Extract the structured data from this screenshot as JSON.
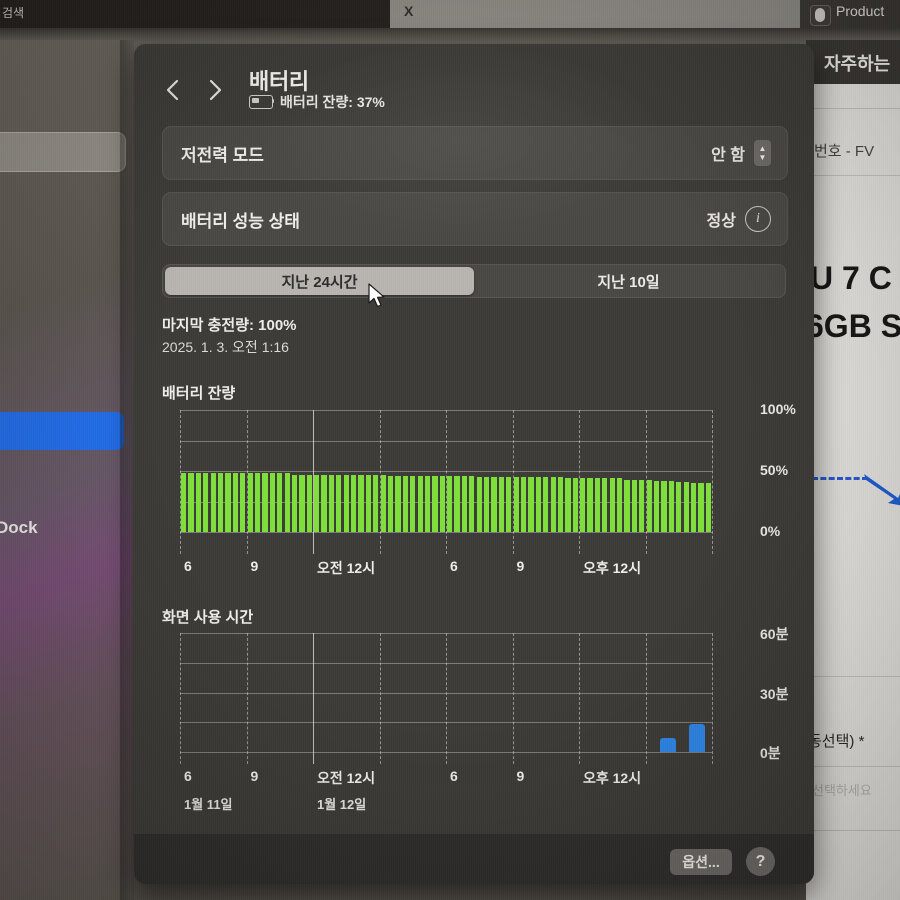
{
  "backdrop": {
    "topbar": {
      "search_text": "검색",
      "close_label": "X",
      "product_label": "Product"
    },
    "left_desktop": {
      "dock_label": "Dock"
    },
    "right_desktop": {
      "header": "자주하는",
      "subtitle": "번호 - FV",
      "big_line1": "U 7 C",
      "big_line2": "6GB S",
      "small_line": "동선택) *",
      "faint_line": "선택하세요"
    }
  },
  "window": {
    "title": "배터리",
    "subtitle": "배터리 잔량: 37%",
    "back_icon": "chevron-left-icon",
    "forward_icon": "chevron-right-icon",
    "rows": [
      {
        "label": "저전력 모드",
        "value": "안 함",
        "control": "stepper"
      },
      {
        "label": "배터리 성능 상태",
        "value": "정상",
        "control": "info"
      }
    ],
    "segments": [
      {
        "label": "지난 24시간",
        "selected": true
      },
      {
        "label": "지난 10일",
        "selected": false
      }
    ],
    "last_charge_label": "마지막 충전량: 100%",
    "last_charge_time": "2025. 1. 3. 오전 1:16",
    "footer": {
      "options_label": "옵션...",
      "help_label": "?"
    }
  },
  "chart_data": [
    {
      "type": "bar",
      "title": "배터리 잔량",
      "xlabel": "",
      "ylabel": "",
      "ylim": [
        0,
        100
      ],
      "ytick_labels": [
        "0%",
        "50%",
        "100%"
      ],
      "yticks": [
        0,
        50,
        100
      ],
      "gridlines_y": [
        0,
        25,
        50,
        75,
        100
      ],
      "xtick_labels": [
        "6",
        "9",
        "오전 12시",
        "6",
        "9",
        "오후 12시"
      ],
      "xticks_hours": [
        6,
        9,
        12,
        18,
        21,
        24
      ],
      "bar_color": "#7ee03a",
      "grid": true,
      "legend": "none",
      "x": [
        "06:00",
        "06:15",
        "06:30",
        "06:45",
        "07:00",
        "07:15",
        "07:30",
        "07:45",
        "08:00",
        "08:15",
        "08:30",
        "08:45",
        "09:00",
        "09:15",
        "09:30",
        "09:45",
        "10:00",
        "10:15",
        "10:30",
        "10:45",
        "11:00",
        "11:15",
        "11:30",
        "11:45",
        "12:00",
        "12:15",
        "12:30",
        "12:45",
        "13:00",
        "13:15",
        "13:30",
        "13:45",
        "14:00",
        "14:15",
        "14:30",
        "14:45",
        "15:00",
        "15:15",
        "15:30",
        "15:45",
        "16:00",
        "16:15",
        "16:30",
        "16:45",
        "17:00",
        "17:15",
        "17:30",
        "17:45",
        "18:00",
        "18:15",
        "18:30",
        "18:45",
        "19:00",
        "19:15",
        "19:30",
        "19:45",
        "20:00",
        "20:15",
        "20:30",
        "20:45",
        "21:00",
        "21:15",
        "21:30",
        "21:45",
        "22:00",
        "22:15",
        "22:30",
        "22:45",
        "23:00",
        "23:15",
        "23:30",
        "23:45"
      ],
      "values": [
        48,
        48,
        48,
        48,
        48,
        48,
        48,
        48,
        48,
        48,
        48,
        48,
        48,
        48,
        48,
        47,
        47,
        47,
        47,
        47,
        47,
        47,
        47,
        47,
        47,
        47,
        47,
        47,
        46,
        46,
        46,
        46,
        46,
        46,
        46,
        46,
        46,
        46,
        46,
        46,
        45,
        45,
        45,
        45,
        45,
        45,
        45,
        45,
        45,
        45,
        45,
        45,
        44,
        44,
        44,
        44,
        44,
        44,
        44,
        44,
        43,
        43,
        43,
        43,
        42,
        42,
        42,
        41,
        41,
        40,
        40,
        40
      ]
    },
    {
      "type": "bar",
      "title": "화면 사용 시간",
      "xlabel": "",
      "ylabel": "",
      "ylim": [
        0,
        60
      ],
      "ytick_labels": [
        "0분",
        "30분",
        "60분"
      ],
      "yticks": [
        0,
        30,
        60
      ],
      "gridlines_y": [
        0,
        15,
        30,
        45,
        60
      ],
      "xtick_labels": [
        "6",
        "9",
        "오전 12시",
        "6",
        "9",
        "오후 12시"
      ],
      "xticks_hours": [
        6,
        9,
        12,
        18,
        21,
        24
      ],
      "xdate_labels": [
        "1월 11일",
        "1월 12일"
      ],
      "bar_color": "#2f86e8",
      "grid": true,
      "legend": "none",
      "x": [
        "06:00",
        "07:00",
        "08:00",
        "09:00",
        "10:00",
        "11:00",
        "12:00",
        "13:00",
        "14:00",
        "15:00",
        "16:00",
        "17:00",
        "18:00",
        "19:00",
        "20:00",
        "21:00",
        "22:00",
        "23:00"
      ],
      "values": [
        0,
        0,
        0,
        0,
        0,
        0,
        0,
        0,
        0,
        0,
        0,
        0,
        0,
        0,
        0,
        0,
        7,
        14
      ]
    }
  ]
}
